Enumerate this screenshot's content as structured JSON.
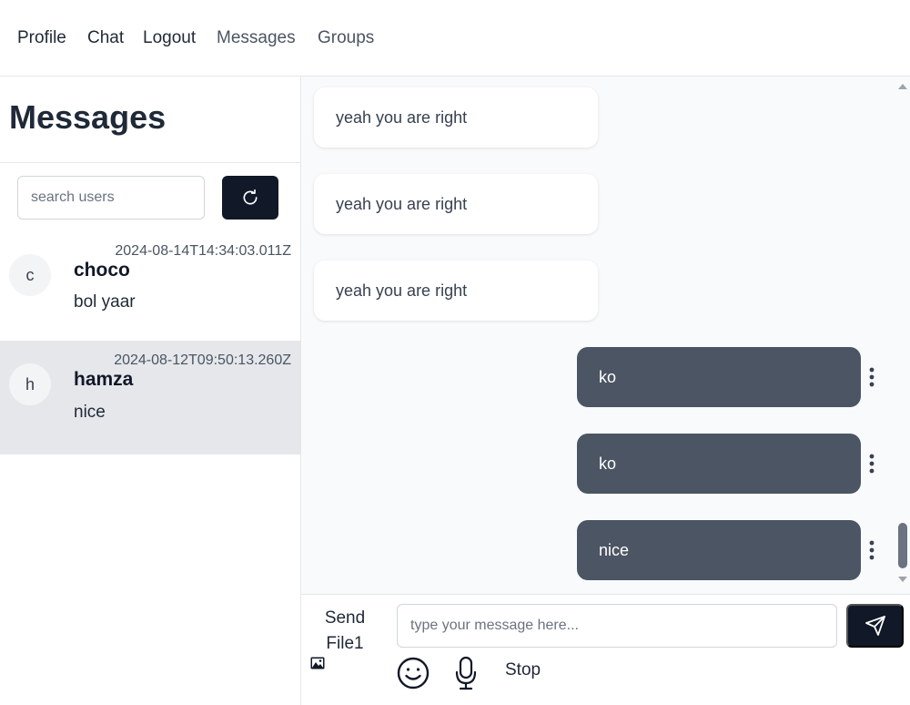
{
  "nav": {
    "profile": "Profile",
    "chat": "Chat",
    "logout": "Logout",
    "messages": "Messages",
    "groups": "Groups"
  },
  "sidebar": {
    "title": "Messages",
    "search_placeholder": "search users",
    "refresh_icon": "refresh-icon",
    "conversations": [
      {
        "initial": "c",
        "name": "choco",
        "last": "bol yaar",
        "time": "2024-08-14T14:34:03.011Z"
      },
      {
        "initial": "h",
        "name": "hamza",
        "last": "nice",
        "time": "2024-08-12T09:50:13.260Z"
      }
    ]
  },
  "chat": {
    "messages": [
      {
        "dir": "in",
        "text": "yeah you are right"
      },
      {
        "dir": "in",
        "text": "yeah you are right"
      },
      {
        "dir": "in",
        "text": "yeah you are right"
      },
      {
        "dir": "out",
        "text": "ko"
      },
      {
        "dir": "out",
        "text": "ko"
      },
      {
        "dir": "out",
        "text": "nice"
      }
    ]
  },
  "composer": {
    "send_file": "Send File1",
    "placeholder": "type your message here...",
    "stop": "Stop",
    "icons": [
      "image-icon",
      "send-icon",
      "emoji-icon",
      "microphone-icon"
    ]
  },
  "colors": {
    "outgoing_bubble": "#4b5563",
    "dark_button": "#111827",
    "active_conversation": "#e5e7eb"
  }
}
